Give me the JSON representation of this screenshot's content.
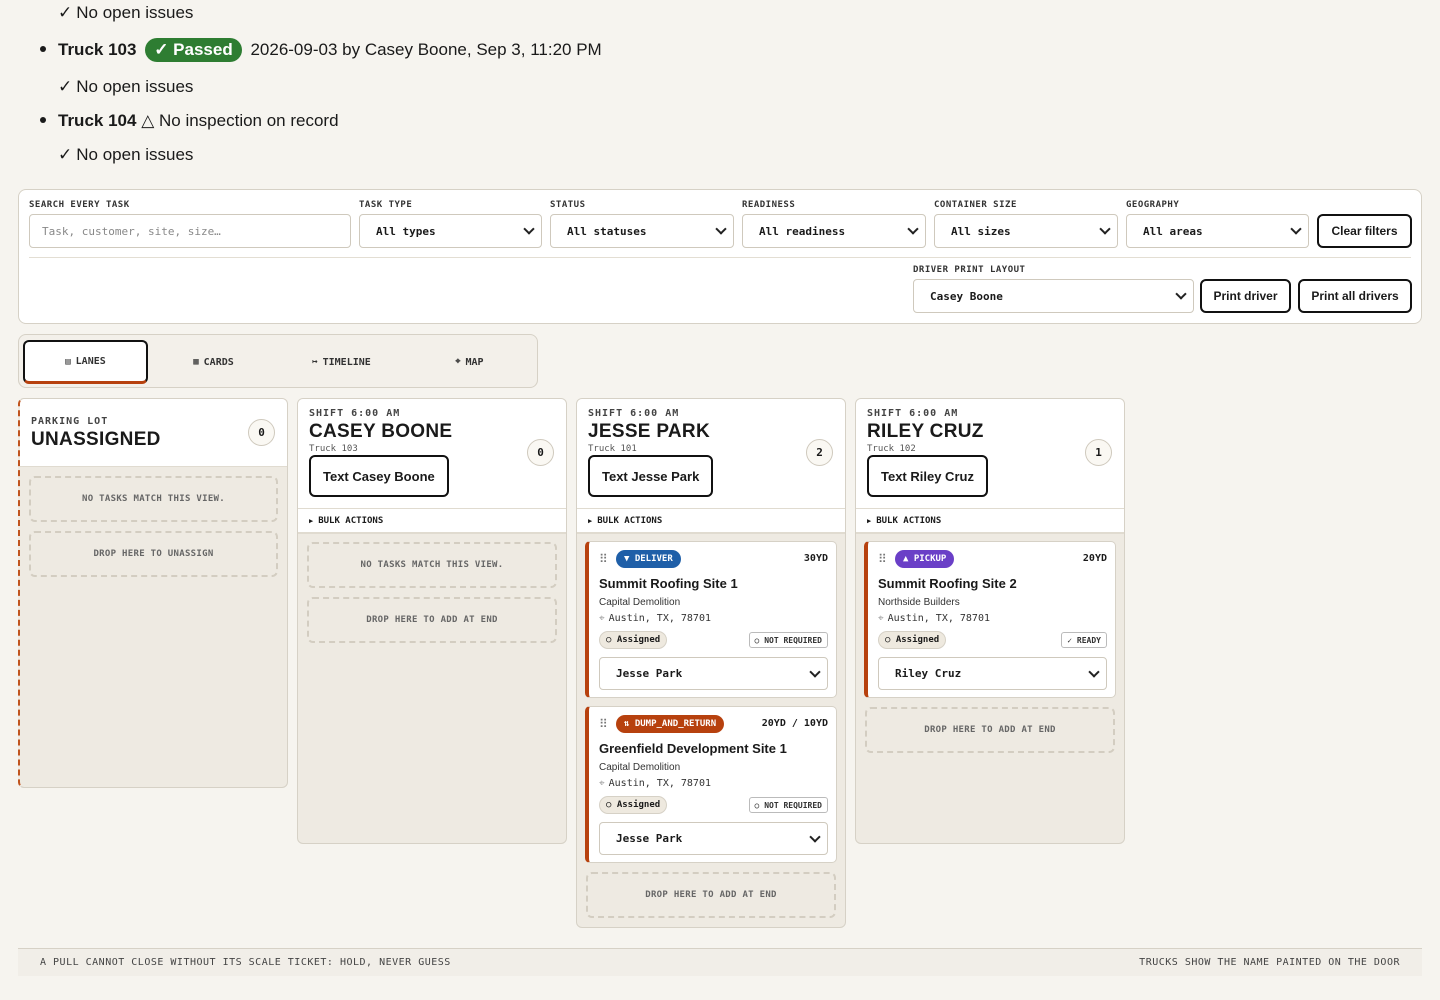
{
  "inspections": {
    "first_issue_text": "No open issues",
    "trucks": [
      {
        "name": "Truck 103",
        "badge": "Passed",
        "detail": "2026-09-03 by Casey Boone, Sep 3, 11:20 PM",
        "issues": "No open issues"
      },
      {
        "name": "Truck 104",
        "warning": "No inspection on record",
        "issues": "No open issues"
      }
    ]
  },
  "filters": {
    "search_label": "SEARCH EVERY TASK",
    "search_placeholder": "Task, customer, site, size…",
    "task_type_label": "TASK TYPE",
    "task_type_value": "All types",
    "status_label": "STATUS",
    "status_value": "All statuses",
    "readiness_label": "READINESS",
    "readiness_value": "All readiness",
    "container_size_label": "CONTAINER SIZE",
    "container_size_value": "All sizes",
    "geography_label": "GEOGRAPHY",
    "geography_value": "All areas",
    "clear_label": "Clear filters",
    "print_layout_label": "DRIVER PRINT LAYOUT",
    "print_layout_value": "Casey Boone",
    "print_driver_label": "Print driver",
    "print_all_label": "Print all drivers"
  },
  "tabs": [
    {
      "icon": "▤",
      "label": "LANES",
      "active": true
    },
    {
      "icon": "▦",
      "label": "CARDS"
    },
    {
      "icon": "↦",
      "label": "TIMELINE"
    },
    {
      "icon": "⌖",
      "label": "MAP"
    }
  ],
  "lanes": {
    "unassigned": {
      "kicker": "PARKING LOT",
      "title": "UNASSIGNED",
      "count": "0",
      "empty_text": "NO TASKS MATCH THIS VIEW.",
      "drop_text": "DROP HERE TO UNASSIGN"
    },
    "casey": {
      "kicker": "SHIFT 6:00 AM",
      "title": "CASEY BOONE",
      "truck": "Truck 103",
      "count": "0",
      "text_button": "Text Casey Boone",
      "bulk": "BULK ACTIONS",
      "empty_text": "NO TASKS MATCH THIS VIEW.",
      "drop_text": "DROP HERE TO ADD AT END"
    },
    "jesse": {
      "kicker": "SHIFT 6:00 AM",
      "title": "JESSE PARK",
      "truck": "Truck 101",
      "count": "2",
      "text_button": "Text Jesse Park",
      "bulk": "BULK ACTIONS",
      "drop_text": "DROP HERE TO ADD AT END",
      "cards": [
        {
          "type": "DELIVER",
          "type_icon": "▼",
          "type_color": "#1f5fa8",
          "size": "30YD",
          "site": "Summit Roofing Site 1",
          "customer": "Capital Demolition",
          "location": "Austin, TX, 78701",
          "status": "Assigned",
          "readiness": "NOT REQUIRED",
          "driver": "Jesse Park"
        },
        {
          "type": "DUMP_AND_RETURN",
          "type_icon": "⇅",
          "type_color": "#b7410e",
          "size": "20YD / 10YD",
          "site": "Greenfield Development Site 1",
          "customer": "Capital Demolition",
          "location": "Austin, TX, 78701",
          "status": "Assigned",
          "readiness": "NOT REQUIRED",
          "driver": "Jesse Park"
        }
      ]
    },
    "riley": {
      "kicker": "SHIFT 6:00 AM",
      "title": "RILEY CRUZ",
      "truck": "Truck 102",
      "count": "1",
      "text_button": "Text Riley Cruz",
      "bulk": "BULK ACTIONS",
      "drop_text": "DROP HERE TO ADD AT END",
      "cards": [
        {
          "type": "PICKUP",
          "type_icon": "▲",
          "type_color": "#6a3fc7",
          "size": "20YD",
          "site": "Summit Roofing Site 2",
          "customer": "Northside Builders",
          "location": "Austin, TX, 78701",
          "status": "Assigned",
          "readiness": "READY",
          "driver": "Riley Cruz"
        }
      ]
    }
  },
  "footer": {
    "left": "A PULL CANNOT CLOSE WITHOUT ITS SCALE TICKET: HOLD, NEVER GUESS",
    "right": "TRUCKS SHOW THE NAME PAINTED ON THE DOOR"
  }
}
